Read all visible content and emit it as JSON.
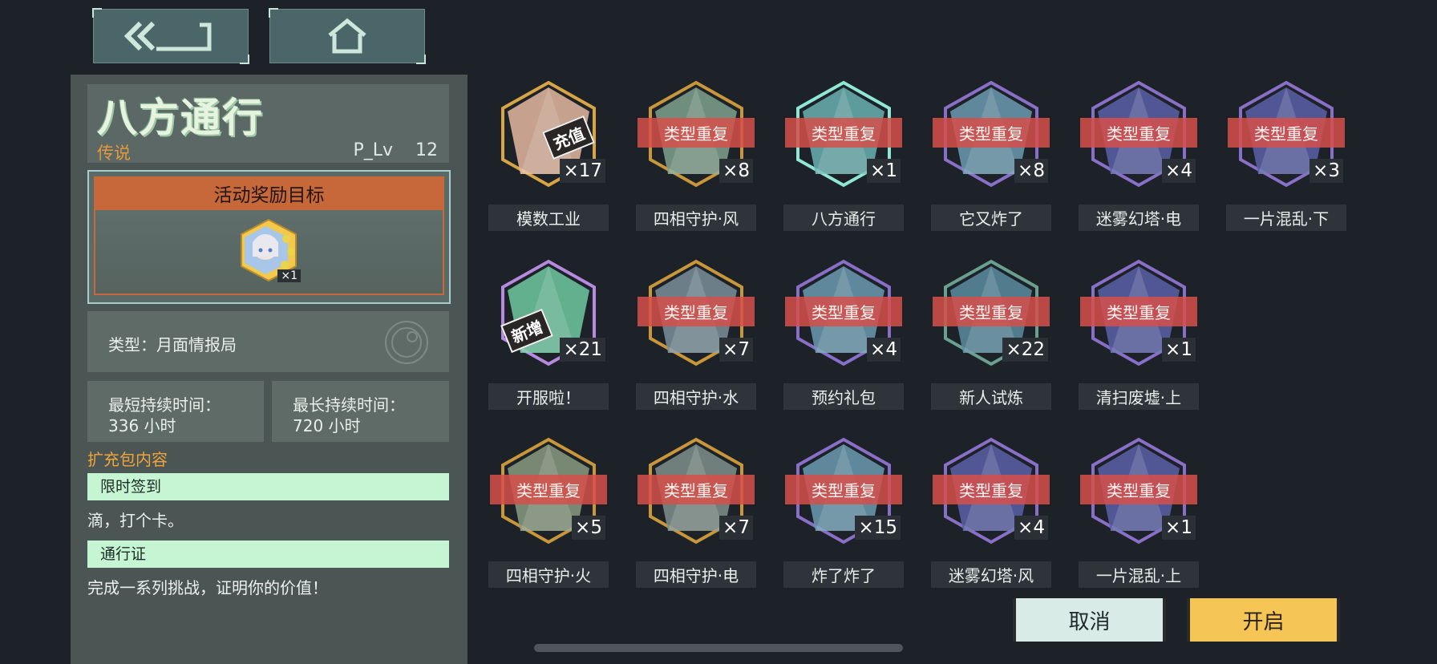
{
  "nav": {
    "back_icon": "double-chevron-left-icon",
    "home_icon": "home-icon"
  },
  "pack": {
    "title": "八方通行",
    "rarity": "传说",
    "plv_label": "P_Lv",
    "plv_value": "12"
  },
  "reward": {
    "header": "活动奖励目标",
    "count": "×1"
  },
  "info": {
    "type_text": "类型：月面情报局",
    "min_label": "最短持续时间：",
    "min_value": "336 小时",
    "max_label": "最长持续时间：",
    "max_value": "720 小时"
  },
  "contents": {
    "section_title": "扩充包内容",
    "items": [
      {
        "tag": "限时签到",
        "desc": "滴，打个卡。"
      },
      {
        "tag": "通行证",
        "desc": "完成一系列挑战，证明你的价值！"
      }
    ]
  },
  "colors": {
    "accent_orange": "#c7683a",
    "legendary": "#e39a3c",
    "open_button": "#f5c556",
    "dup_banner": "#d64f4a"
  },
  "dup_label": "类型重复",
  "stamps": {
    "recharge": "充值",
    "new": "新增"
  },
  "cards": [
    {
      "name": "模数工业",
      "count": "×17",
      "dup": false,
      "frame": "#d9a542",
      "fill": "#e4b8a0"
    },
    {
      "name": "四相守护·风",
      "count": "×8",
      "dup": true,
      "frame": "#c99739",
      "fill": "#7fa18c"
    },
    {
      "name": "八方通行",
      "count": "×1",
      "dup": true,
      "frame": "#8fe8d4",
      "fill": "#6ab0b0"
    },
    {
      "name": "它又炸了",
      "count": "×8",
      "dup": true,
      "frame": "#8a6fc8",
      "fill": "#6b9ab0"
    },
    {
      "name": "迷雾幻塔·电",
      "count": "×4",
      "dup": true,
      "frame": "#8a6fc8",
      "fill": "#5a5fa8"
    },
    {
      "name": "一片混乱·下",
      "count": "×3",
      "dup": true,
      "frame": "#8a6fc8",
      "fill": "#5a5fa8"
    },
    {
      "name": "开服啦！",
      "count": "×21",
      "dup": false,
      "frame": "#b78ae0",
      "fill": "#6fc9a0"
    },
    {
      "name": "四相守护·水",
      "count": "×7",
      "dup": true,
      "frame": "#c99739",
      "fill": "#7a8f9a"
    },
    {
      "name": "预约礼包",
      "count": "×4",
      "dup": true,
      "frame": "#8a6fc8",
      "fill": "#6b9ab0"
    },
    {
      "name": "新人试炼",
      "count": "×22",
      "dup": true,
      "frame": "#6aa090",
      "fill": "#5a8ca0"
    },
    {
      "name": "清扫废墟·上",
      "count": "×1",
      "dup": true,
      "frame": "#8a6fc8",
      "fill": "#5a5fa8"
    },
    {
      "name": "四相守护·火",
      "count": "×5",
      "dup": true,
      "frame": "#c99739",
      "fill": "#8a9a80"
    },
    {
      "name": "四相守护·电",
      "count": "×7",
      "dup": true,
      "frame": "#c99739",
      "fill": "#7f8f8a"
    },
    {
      "name": "炸了炸了",
      "count": "×15",
      "dup": true,
      "frame": "#8a6fc8",
      "fill": "#6b9ab0"
    },
    {
      "name": "迷雾幻塔·风",
      "count": "×4",
      "dup": true,
      "frame": "#8a6fc8",
      "fill": "#5a5fa8"
    },
    {
      "name": "一片混乱·上",
      "count": "×1",
      "dup": true,
      "frame": "#8a6fc8",
      "fill": "#5a5fa8"
    }
  ],
  "buttons": {
    "cancel": "取消",
    "open": "开启"
  }
}
